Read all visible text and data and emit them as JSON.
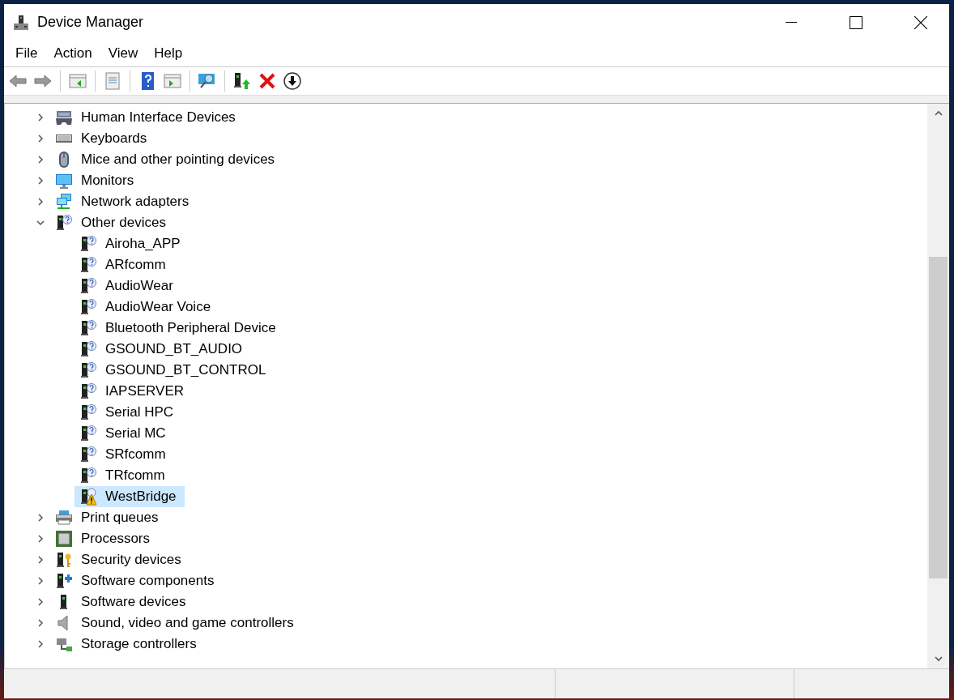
{
  "window": {
    "title": "Device Manager"
  },
  "menu": [
    "File",
    "Action",
    "View",
    "Help"
  ],
  "tree": [
    {
      "label": "Human Interface Devices",
      "kind": "hid",
      "expanded": false,
      "selected": false
    },
    {
      "label": "Keyboards",
      "kind": "keyboard",
      "expanded": false,
      "selected": false
    },
    {
      "label": "Mice and other pointing devices",
      "kind": "mouse",
      "expanded": false,
      "selected": false
    },
    {
      "label": "Monitors",
      "kind": "monitor",
      "expanded": false,
      "selected": false
    },
    {
      "label": "Network adapters",
      "kind": "network",
      "expanded": false,
      "selected": false
    },
    {
      "label": "Other devices",
      "kind": "unknown",
      "expanded": true,
      "selected": false,
      "children": [
        {
          "label": "Airoha_APP",
          "kind": "unknown",
          "selected": false
        },
        {
          "label": "ARfcomm",
          "kind": "unknown",
          "selected": false
        },
        {
          "label": "AudioWear",
          "kind": "unknown",
          "selected": false
        },
        {
          "label": "AudioWear Voice",
          "kind": "unknown",
          "selected": false
        },
        {
          "label": "Bluetooth Peripheral Device",
          "kind": "unknown",
          "selected": false
        },
        {
          "label": "GSOUND_BT_AUDIO",
          "kind": "unknown",
          "selected": false
        },
        {
          "label": "GSOUND_BT_CONTROL",
          "kind": "unknown",
          "selected": false
        },
        {
          "label": "IAPSERVER",
          "kind": "unknown",
          "selected": false
        },
        {
          "label": "Serial HPC",
          "kind": "unknown",
          "selected": false
        },
        {
          "label": "Serial MC",
          "kind": "unknown",
          "selected": false
        },
        {
          "label": "SRfcomm",
          "kind": "unknown",
          "selected": false
        },
        {
          "label": "TRfcomm",
          "kind": "unknown",
          "selected": false
        },
        {
          "label": "WestBridge",
          "kind": "warning",
          "selected": true
        }
      ]
    },
    {
      "label": "Print queues",
      "kind": "printer",
      "expanded": false,
      "selected": false
    },
    {
      "label": "Processors",
      "kind": "processor",
      "expanded": false,
      "selected": false
    },
    {
      "label": "Security devices",
      "kind": "security",
      "expanded": false,
      "selected": false
    },
    {
      "label": "Software components",
      "kind": "component",
      "expanded": false,
      "selected": false
    },
    {
      "label": "Software devices",
      "kind": "software",
      "expanded": false,
      "selected": false
    },
    {
      "label": "Sound, video and game controllers",
      "kind": "sound",
      "expanded": false,
      "selected": false
    },
    {
      "label": "Storage controllers",
      "kind": "storage",
      "expanded": false,
      "selected": false
    }
  ]
}
